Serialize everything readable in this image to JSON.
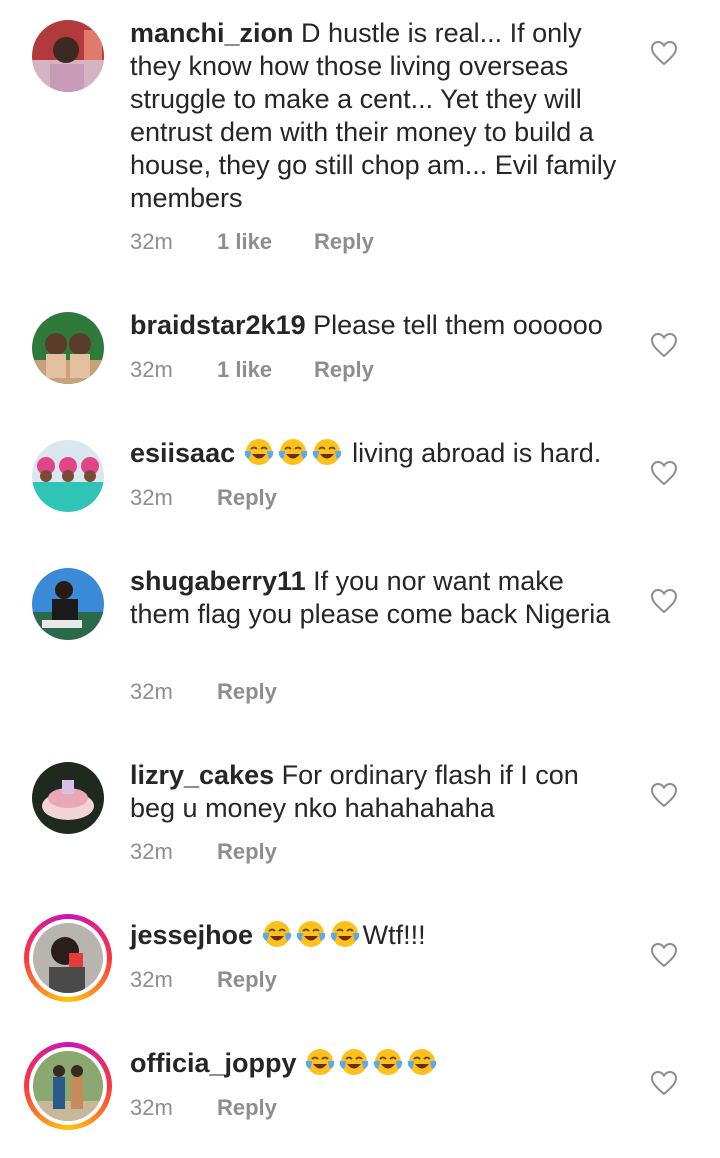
{
  "comments": [
    {
      "username": "manchi_zion",
      "text": "D hustle is real... If only they know how those living overseas struggle to make a cent... Yet they will entrust dem with their money to build a house, they go still chop am... Evil family members",
      "time": "32m",
      "likes": "1 like",
      "reply": "Reply"
    },
    {
      "username": "braidstar2k19",
      "text": "Please tell them oooooo",
      "time": "32m",
      "likes": "1 like",
      "reply": "Reply"
    },
    {
      "username": "esiisaac",
      "emojis": "😂😂😂",
      "text": "living abroad is hard.",
      "time": "32m",
      "reply": "Reply"
    },
    {
      "username": "shugaberry11",
      "text": "If you nor want make them flag you please come back Nigeria",
      "time": "32m",
      "reply": "Reply"
    },
    {
      "username": "lizry_cakes",
      "text": "For ordinary flash if I con beg u money nko hahahahaha",
      "time": "32m",
      "reply": "Reply"
    },
    {
      "username": "jessejhoe",
      "emojis": "😂😂😂",
      "text": "Wtf!!!",
      "time": "32m",
      "reply": "Reply"
    },
    {
      "username": "officia_joppy",
      "emojis": "😂😂😂😂",
      "time": "32m",
      "reply": "Reply"
    }
  ],
  "icons": {
    "like": "heart-outline-icon",
    "emoji": "face-with-tears-of-joy"
  },
  "colors": {
    "text": "#262626",
    "meta": "#8e8e8e",
    "story_ring": "#c913b9"
  }
}
